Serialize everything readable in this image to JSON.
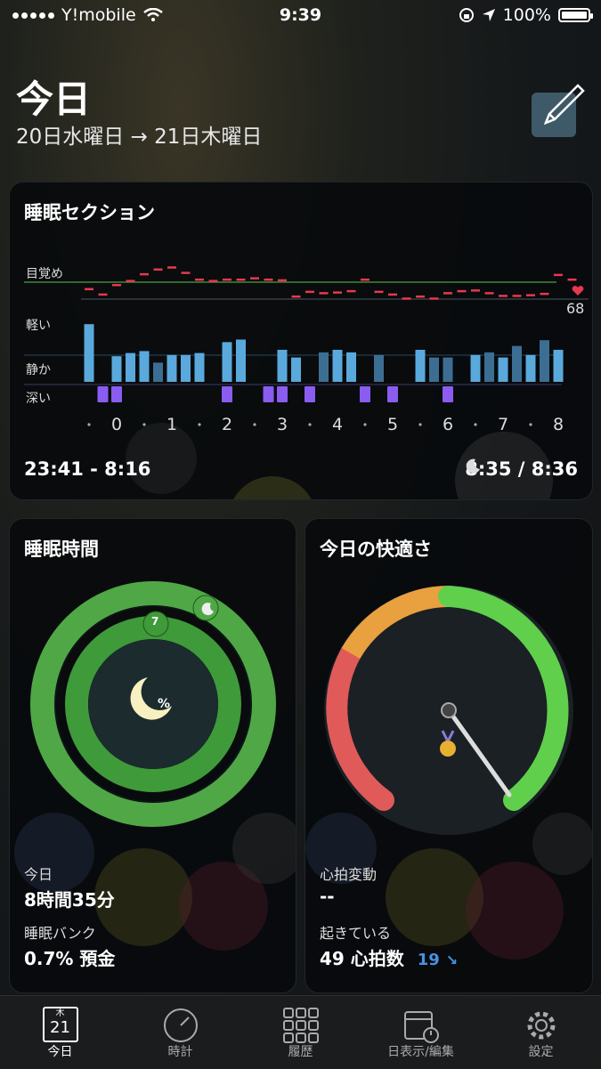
{
  "status": {
    "carrier": "Y!mobile",
    "time": "9:39",
    "battery": "100%"
  },
  "header": {
    "title": "今日",
    "date_range": "20日水曜日 → 21日木曜日"
  },
  "sleep_section": {
    "title": "睡眠セクション",
    "levels": [
      "目覚め",
      "軽い",
      "静か",
      "深い"
    ],
    "hours": [
      "0",
      "1",
      "2",
      "3",
      "4",
      "5",
      "6",
      "7",
      "8"
    ],
    "heart_rate": "68",
    "time_range": "23:41 - 8:16",
    "total": "8:35 / 8:36"
  },
  "chart_data": {
    "type": "bar",
    "x": [
      -0.5,
      -0.25,
      0,
      0.25,
      0.5,
      0.75,
      1,
      1.25,
      1.5,
      1.75,
      2,
      2.25,
      2.5,
      2.75,
      3,
      3.25,
      3.5,
      3.75,
      4,
      4.25,
      4.5,
      4.75,
      5,
      5.25,
      5.5,
      5.75,
      6,
      6.25,
      6.5,
      6.75,
      7,
      7.25,
      7.5,
      7.75,
      8,
      8.25
    ],
    "movement": [
      0.9,
      0,
      0.4,
      0.45,
      0.48,
      0.3,
      0.42,
      0.42,
      0.45,
      0,
      0.62,
      0.66,
      0,
      0,
      0.5,
      0.38,
      0,
      0.46,
      0.5,
      0.46,
      0,
      0.42,
      0,
      0,
      0.5,
      0.38,
      0.38,
      0,
      0.42,
      0.46,
      0.38,
      0.56,
      0.42,
      0.65,
      0.5,
      0
    ],
    "deep_sleep": [
      0,
      1,
      1,
      0,
      0,
      0,
      0,
      0,
      0,
      0,
      1,
      0,
      0,
      1,
      1,
      0,
      1,
      0,
      0,
      0,
      1,
      0,
      1,
      0,
      0,
      0,
      1,
      0,
      0,
      0,
      0,
      0,
      0,
      0,
      0,
      0
    ],
    "heart": [
      0.66,
      0.58,
      0.72,
      0.78,
      0.88,
      0.95,
      0.98,
      0.9,
      0.8,
      0.78,
      0.8,
      0.8,
      0.82,
      0.8,
      0.79,
      0.55,
      0.62,
      0.6,
      0.61,
      0.63,
      0.8,
      0.62,
      0.58,
      0.52,
      0.55,
      0.52,
      0.6,
      0.63,
      0.64,
      0.6,
      0.56,
      0.56,
      0.57,
      0.59,
      0.87,
      0.8
    ]
  },
  "sleep_duration": {
    "title": "睡眠時間",
    "marker": "7",
    "center": "%",
    "today_label": "今日",
    "today_value": "8時間35分",
    "bank_label": "睡眠バンク",
    "bank_value": "0.7% 預金"
  },
  "comfort": {
    "title": "今日の快適さ",
    "hrv_label": "心拍変動",
    "hrv_value": "--",
    "awake_label": "起きている",
    "awake_value": "49 心拍数",
    "awake_delta": "19",
    "colors": {
      "red": "#e05a5a",
      "orange": "#e8a13e",
      "green": "#5fcf4c"
    }
  },
  "tabs": [
    {
      "label": "今日",
      "icon": "calendar-icon",
      "day": "21",
      "weekday": "木"
    },
    {
      "label": "時計",
      "icon": "clock-icon"
    },
    {
      "label": "履歴",
      "icon": "grid-icon"
    },
    {
      "label": "日表示/編集",
      "icon": "calendar-edit-icon"
    },
    {
      "label": "設定",
      "icon": "gear-icon"
    }
  ]
}
